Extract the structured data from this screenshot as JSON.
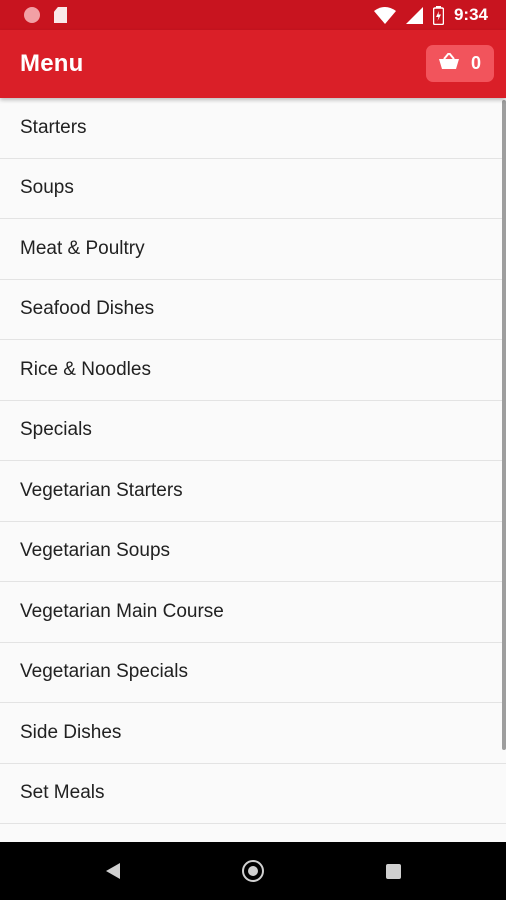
{
  "status_bar": {
    "time": "9:34",
    "icons": [
      "record-icon",
      "sd-card-icon",
      "wifi-icon",
      "cell-signal-icon",
      "battery-icon"
    ]
  },
  "app_bar": {
    "title": "Menu",
    "cart_count": "0",
    "cart_icon": "basket-icon"
  },
  "menu": {
    "items": [
      {
        "label": "Starters"
      },
      {
        "label": "Soups"
      },
      {
        "label": "Meat & Poultry"
      },
      {
        "label": "Seafood Dishes"
      },
      {
        "label": "Rice & Noodles"
      },
      {
        "label": "Specials"
      },
      {
        "label": "Vegetarian Starters"
      },
      {
        "label": "Vegetarian Soups"
      },
      {
        "label": "Vegetarian Main Course"
      },
      {
        "label": "Vegetarian Specials"
      },
      {
        "label": "Side Dishes"
      },
      {
        "label": "Set Meals"
      }
    ]
  },
  "nav_bar": {
    "icons": [
      "back-icon",
      "home-icon",
      "recents-icon"
    ]
  },
  "colors": {
    "status_bar": "#c8141f",
    "app_bar": "#da1f28",
    "cart_button": "#f2545c"
  }
}
